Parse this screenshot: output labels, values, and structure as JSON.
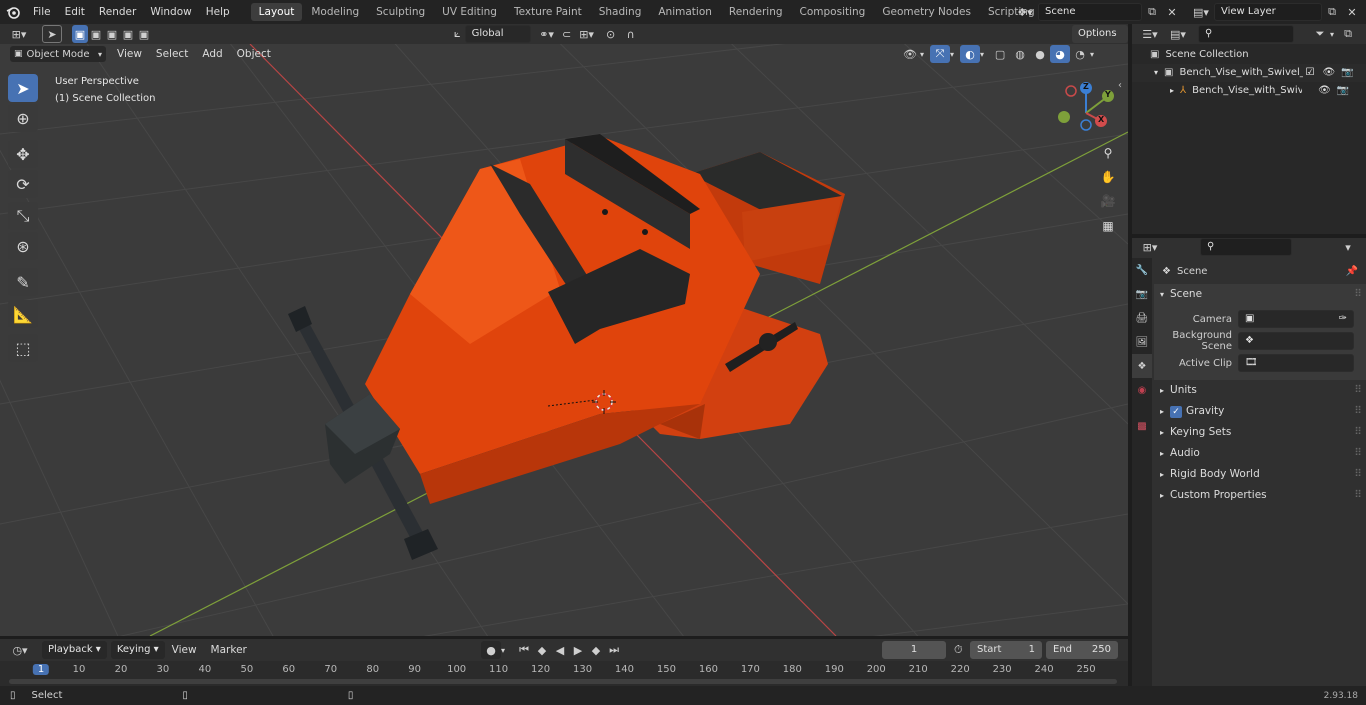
{
  "menu": [
    "File",
    "Edit",
    "Render",
    "Window",
    "Help"
  ],
  "workspaces": [
    "Layout",
    "Modeling",
    "Sculpting",
    "UV Editing",
    "Texture Paint",
    "Shading",
    "Animation",
    "Rendering",
    "Compositing",
    "Geometry Nodes",
    "Scripting"
  ],
  "active_workspace": "Layout",
  "scene_name": "Scene",
  "view_layer": "View Layer",
  "header": {
    "mode": "Object Mode",
    "view": "View",
    "select": "Select",
    "add": "Add",
    "object": "Object",
    "transform": "Global",
    "options": "Options"
  },
  "viewport": {
    "perspective": "User Perspective",
    "collection": "(1) Scene Collection",
    "gizmo": {
      "z": "Z",
      "y": "Y",
      "x": "X"
    }
  },
  "outliner": {
    "root": "Scene Collection",
    "items": [
      "Bench_Vise_with_Swivel_Bas",
      "Bench_Vise_with_Swivel_"
    ]
  },
  "properties": {
    "breadcrumb": "Scene",
    "panel": "Scene",
    "camera_label": "Camera",
    "bg_scene_label": "Background Scene",
    "active_clip_label": "Active Clip",
    "subpanels": [
      "Units",
      "Gravity",
      "Keying Sets",
      "Audio",
      "Rigid Body World",
      "Custom Properties"
    ]
  },
  "timeline": {
    "playback": "Playback",
    "keying": "Keying",
    "view": "View",
    "marker": "Marker",
    "current_frame": "1",
    "start_label": "Start",
    "start": "1",
    "end_label": "End",
    "end": "250",
    "ruler": [
      "1",
      "10",
      "20",
      "30",
      "40",
      "50",
      "60",
      "70",
      "80",
      "90",
      "100",
      "110",
      "120",
      "130",
      "140",
      "150",
      "160",
      "170",
      "180",
      "190",
      "200",
      "210",
      "220",
      "230",
      "240",
      "250"
    ]
  },
  "status": {
    "left": "Select",
    "version": "2.93.18"
  },
  "colors": {
    "accent": "#4772b3",
    "vise_body": "#e0440c",
    "x_axis": "#c84a4a",
    "y_axis": "#7ea03a"
  }
}
